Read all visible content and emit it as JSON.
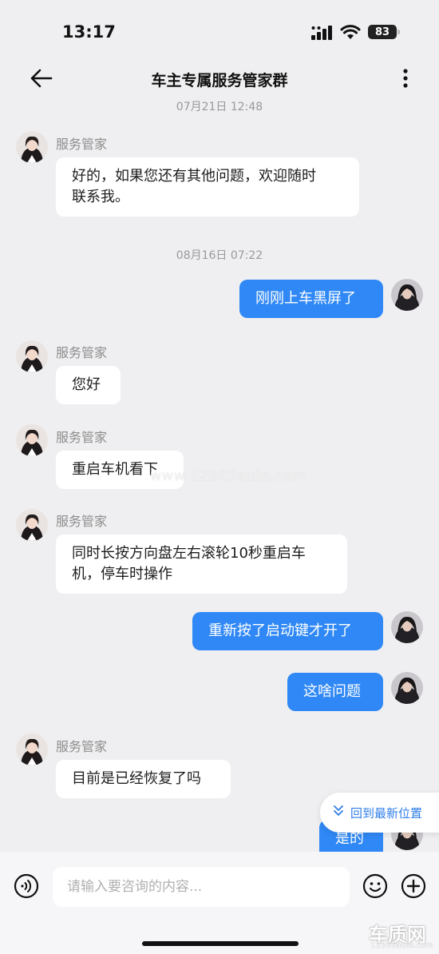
{
  "status_bar": {
    "time": "13:17",
    "battery": "83"
  },
  "header": {
    "title": "车主专属服务管家群"
  },
  "dividers": [
    "07月21日 12:48",
    "08月16日 07:22"
  ],
  "agent_name": "服务管家",
  "messages": [
    {
      "side": "in",
      "text": "好的，如果您还有其他问题，欢迎随时\n联系我。"
    },
    {
      "side": "out",
      "text": "刚刚上车黑屏了"
    },
    {
      "side": "in",
      "text": "您好"
    },
    {
      "side": "in",
      "text": "重启车机看下"
    },
    {
      "side": "in",
      "text": "同时长按方向盘左右滚轮10秒重启车\n机，停车时操作"
    },
    {
      "side": "out",
      "text": "重新按了启动键才开了"
    },
    {
      "side": "out",
      "text": "这啥问题"
    },
    {
      "side": "in",
      "text": "目前是已经恢复了吗"
    },
    {
      "side": "out",
      "text": "是的"
    }
  ],
  "jump_latest": {
    "label": "回到最新位置"
  },
  "composer": {
    "placeholder": "请输入要咨询的内容..."
  },
  "watermark": "www.12365auto.com",
  "logo": {
    "text": "车质网",
    "sub": "12365auto.com"
  },
  "colors": {
    "outgoing_bubble": "#2f88f5",
    "background": "#efeff1",
    "accent": "#2f7ee8"
  }
}
